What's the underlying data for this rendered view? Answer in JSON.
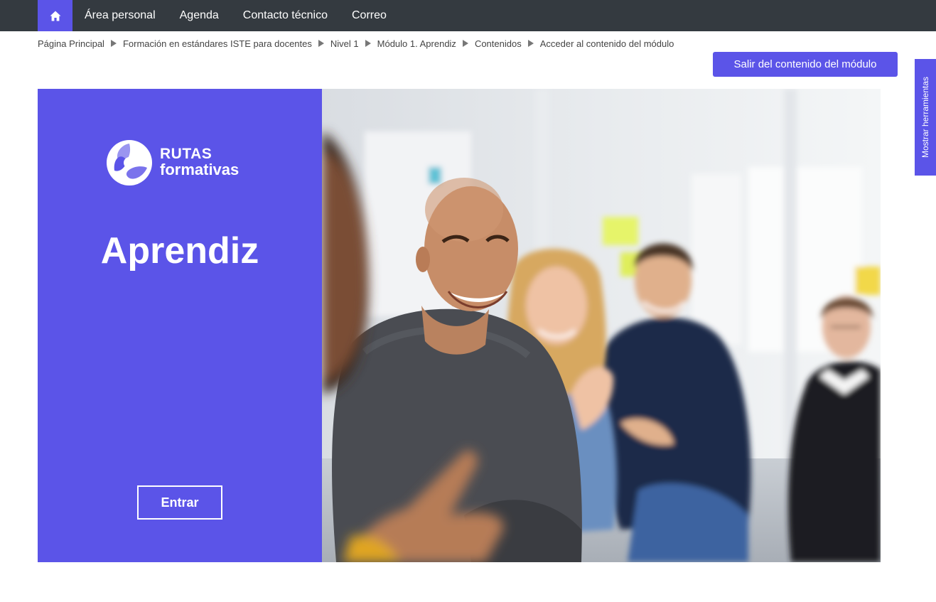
{
  "nav": {
    "home_icon": "home-icon",
    "items": [
      "Área personal",
      "Agenda",
      "Contacto técnico",
      "Correo"
    ]
  },
  "breadcrumb": [
    "Página Principal",
    "Formación en estándares ISTE para docentes",
    "Nivel 1",
    "Módulo 1. Aprendiz",
    "Contenidos",
    "Acceder al contenido del módulo"
  ],
  "exit_button": "Salir del contenido del módulo",
  "tools_tab": "Mostrar herramientas",
  "hero": {
    "logo_line1": "RUTAS",
    "logo_line2": "formativas",
    "title": "Aprendiz",
    "enter_button": "Entrar",
    "photo": "group-of-people-laughing-photo"
  },
  "colors": {
    "accent": "#5b54e8",
    "navbar": "#343a40"
  }
}
